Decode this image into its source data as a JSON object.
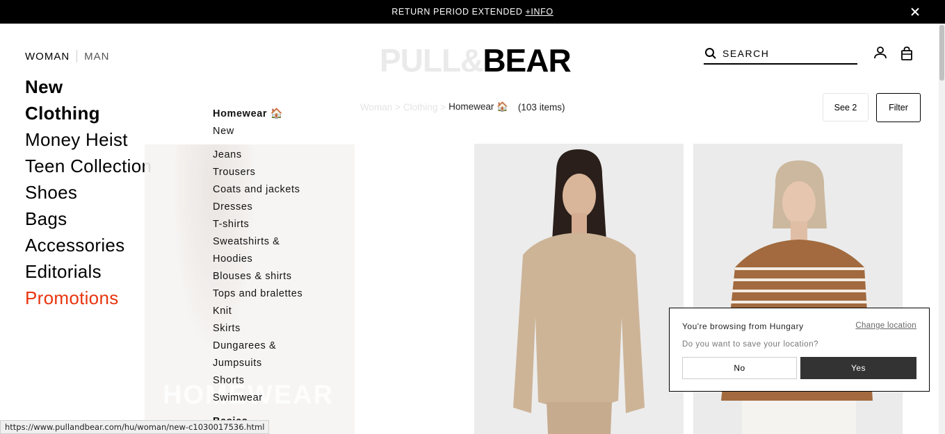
{
  "announcement": {
    "text": "RETURN PERIOD EXTENDED",
    "link": "+INFO"
  },
  "gender": {
    "woman": "WOMAN",
    "man": "MAN"
  },
  "logo": {
    "part1": "PULL&",
    "part2": "BEAR"
  },
  "search": {
    "placeholder": "SEARCH"
  },
  "main_menu": [
    "New",
    "Clothing",
    "Money Heist",
    "Teen Collection",
    "Shoes",
    "Bags",
    "Accessories",
    "Editorials",
    "Promotions"
  ],
  "sub_menu": {
    "heading": "Homewear 🏠",
    "items": [
      "New",
      "Jeans",
      "Trousers",
      "Coats and jackets",
      "Dresses",
      "T-shirts",
      "Sweatshirts &",
      "Hoodies",
      "Blouses & shirts",
      "Tops and bralettes",
      "Knit",
      "Skirts",
      "Dungarees &",
      "Jumpsuits",
      "Shorts",
      "Swimwear",
      "Basics"
    ]
  },
  "banner": {
    "text": "HOMEWEAR"
  },
  "breadcrumb": {
    "level1": "Woman >",
    "level2": "Clothing >",
    "current": "Homewear 🏠",
    "count": "(103 items)"
  },
  "toolbar": {
    "see": "See 2",
    "filter": "Filter"
  },
  "location_popup": {
    "browsing": "You're browsing from Hungary",
    "change": "Change location",
    "question": "Do you want to save your location?",
    "no": "No",
    "yes": "Yes"
  },
  "status_url": "https://www.pullandbear.com/hu/woman/new-c1030017536.html",
  "colors": {
    "promo": "#e8340e",
    "topbar": "#000000",
    "yes_button": "#333333"
  }
}
